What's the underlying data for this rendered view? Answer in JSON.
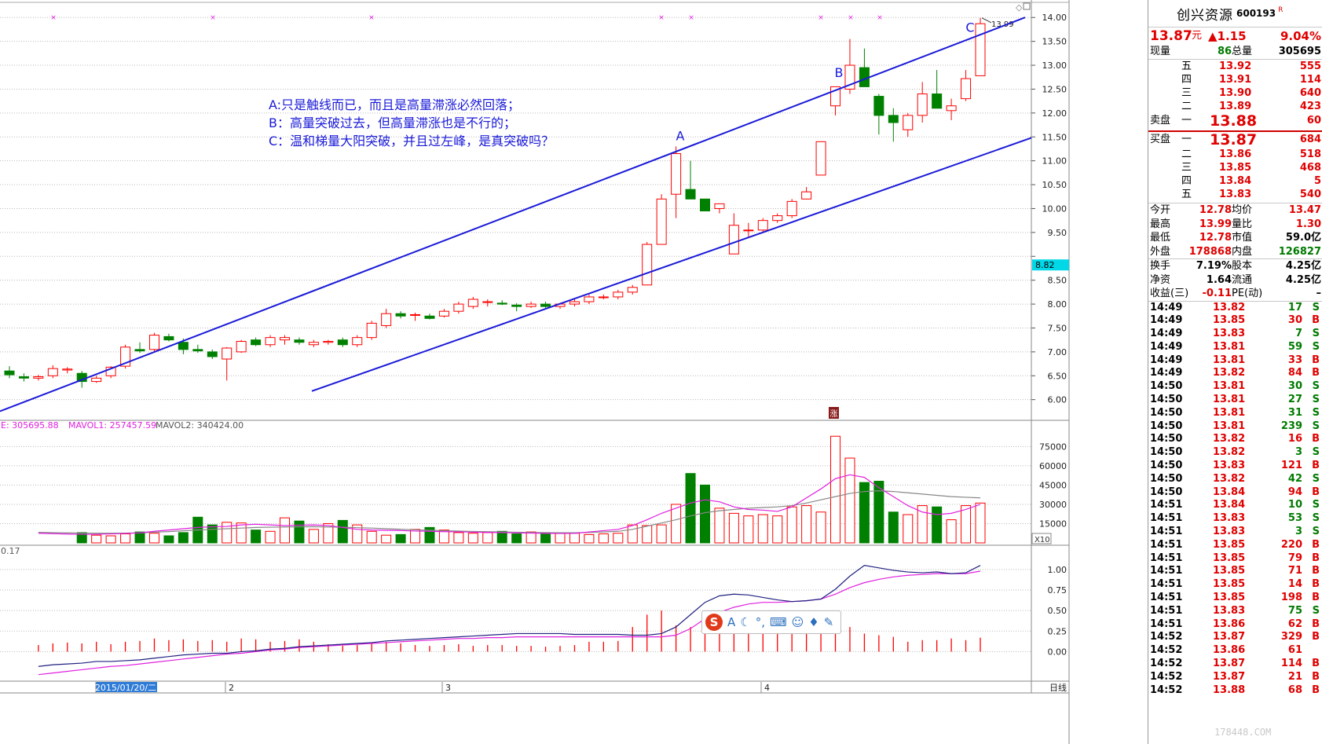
{
  "chart_data": {
    "type": "candlestick",
    "price_axis": {
      "ticks": [
        14.0,
        13.5,
        13.0,
        12.5,
        12.0,
        11.5,
        11.0,
        10.5,
        10.0,
        9.5,
        9.0,
        8.5,
        8.0,
        7.5,
        7.0,
        6.5,
        6.0
      ],
      "labels": [
        "14.00",
        "13.50",
        "13.00",
        "12.50",
        "12.00",
        "11.50",
        "11.00",
        "10.50",
        "10.00",
        "9.50",
        "",
        "8.50",
        "8.00",
        "7.50",
        "7.00",
        "6.50",
        "6.00"
      ],
      "range": [
        5.6,
        14.3
      ]
    },
    "cursor_price": "8.82",
    "high_mark": "13.99",
    "candles": [
      {
        "o": 6.6,
        "h": 6.7,
        "l": 6.45,
        "c": 6.52
      },
      {
        "o": 6.48,
        "h": 6.55,
        "l": 6.38,
        "c": 6.45
      },
      {
        "o": 6.45,
        "h": 6.52,
        "l": 6.4,
        "c": 6.48
      },
      {
        "o": 6.5,
        "h": 6.72,
        "l": 6.45,
        "c": 6.65
      },
      {
        "o": 6.62,
        "h": 6.68,
        "l": 6.55,
        "c": 6.64
      },
      {
        "o": 6.55,
        "h": 6.6,
        "l": 6.25,
        "c": 6.38
      },
      {
        "o": 6.38,
        "h": 6.5,
        "l": 6.35,
        "c": 6.45
      },
      {
        "o": 6.5,
        "h": 6.7,
        "l": 6.45,
        "c": 6.68
      },
      {
        "o": 6.7,
        "h": 7.15,
        "l": 6.65,
        "c": 7.1
      },
      {
        "o": 7.05,
        "h": 7.2,
        "l": 6.98,
        "c": 7.02
      },
      {
        "o": 7.05,
        "h": 7.4,
        "l": 7.0,
        "c": 7.35
      },
      {
        "o": 7.32,
        "h": 7.38,
        "l": 7.22,
        "c": 7.25
      },
      {
        "o": 7.2,
        "h": 7.28,
        "l": 6.95,
        "c": 7.05
      },
      {
        "o": 7.05,
        "h": 7.15,
        "l": 6.98,
        "c": 7.02
      },
      {
        "o": 7.0,
        "h": 7.05,
        "l": 6.85,
        "c": 6.9
      },
      {
        "o": 6.85,
        "h": 7.1,
        "l": 6.4,
        "c": 7.08
      },
      {
        "o": 7.0,
        "h": 7.25,
        "l": 6.98,
        "c": 7.22
      },
      {
        "o": 7.25,
        "h": 7.3,
        "l": 7.12,
        "c": 7.15
      },
      {
        "o": 7.15,
        "h": 7.35,
        "l": 7.1,
        "c": 7.3
      },
      {
        "o": 7.25,
        "h": 7.35,
        "l": 7.15,
        "c": 7.3
      },
      {
        "o": 7.25,
        "h": 7.3,
        "l": 7.15,
        "c": 7.2
      },
      {
        "o": 7.15,
        "h": 7.25,
        "l": 7.1,
        "c": 7.2
      },
      {
        "o": 7.2,
        "h": 7.25,
        "l": 7.15,
        "c": 7.22
      },
      {
        "o": 7.25,
        "h": 7.3,
        "l": 7.1,
        "c": 7.15
      },
      {
        "o": 7.15,
        "h": 7.35,
        "l": 7.1,
        "c": 7.3
      },
      {
        "o": 7.3,
        "h": 7.65,
        "l": 7.25,
        "c": 7.6
      },
      {
        "o": 7.55,
        "h": 7.9,
        "l": 7.5,
        "c": 7.8
      },
      {
        "o": 7.8,
        "h": 7.85,
        "l": 7.7,
        "c": 7.75
      },
      {
        "o": 7.78,
        "h": 7.82,
        "l": 7.65,
        "c": 7.78
      },
      {
        "o": 7.75,
        "h": 7.8,
        "l": 7.68,
        "c": 7.7
      },
      {
        "o": 7.75,
        "h": 7.9,
        "l": 7.72,
        "c": 7.85
      },
      {
        "o": 7.85,
        "h": 8.05,
        "l": 7.8,
        "c": 8.0
      },
      {
        "o": 7.95,
        "h": 8.15,
        "l": 7.9,
        "c": 8.1
      },
      {
        "o": 8.05,
        "h": 8.1,
        "l": 7.95,
        "c": 8.05
      },
      {
        "o": 8.02,
        "h": 8.08,
        "l": 7.98,
        "c": 8.0
      },
      {
        "o": 7.98,
        "h": 8.02,
        "l": 7.85,
        "c": 7.95
      },
      {
        "o": 7.95,
        "h": 8.05,
        "l": 7.92,
        "c": 8.0
      },
      {
        "o": 8.0,
        "h": 8.05,
        "l": 7.92,
        "c": 7.95
      },
      {
        "o": 7.95,
        "h": 8.02,
        "l": 7.9,
        "c": 8.0
      },
      {
        "o": 8.0,
        "h": 8.1,
        "l": 7.95,
        "c": 8.05
      },
      {
        "o": 8.05,
        "h": 8.2,
        "l": 8.0,
        "c": 8.15
      },
      {
        "o": 8.15,
        "h": 8.2,
        "l": 8.1,
        "c": 8.15
      },
      {
        "o": 8.15,
        "h": 8.3,
        "l": 8.1,
        "c": 8.25
      },
      {
        "o": 8.25,
        "h": 8.4,
        "l": 8.2,
        "c": 8.35
      },
      {
        "o": 8.4,
        "h": 9.3,
        "l": 8.4,
        "c": 9.25
      },
      {
        "o": 9.25,
        "h": 10.3,
        "l": 9.4,
        "c": 10.2
      },
      {
        "o": 10.3,
        "h": 11.3,
        "l": 9.8,
        "c": 11.15
      },
      {
        "o": 10.4,
        "h": 11.0,
        "l": 10.3,
        "c": 10.2
      },
      {
        "o": 10.2,
        "h": 10.2,
        "l": 9.95,
        "c": 9.95
      },
      {
        "o": 10.0,
        "h": 10.1,
        "l": 9.9,
        "c": 10.1
      },
      {
        "o": 9.05,
        "h": 9.9,
        "l": 9.05,
        "c": 9.65
      },
      {
        "o": 9.55,
        "h": 9.7,
        "l": 9.4,
        "c": 9.55
      },
      {
        "o": 9.55,
        "h": 9.8,
        "l": 9.5,
        "c": 9.75
      },
      {
        "o": 9.75,
        "h": 9.9,
        "l": 9.7,
        "c": 9.85
      },
      {
        "o": 9.85,
        "h": 10.2,
        "l": 9.8,
        "c": 10.15
      },
      {
        "o": 10.2,
        "h": 10.45,
        "l": 10.2,
        "c": 10.35
      },
      {
        "o": 10.7,
        "h": 11.4,
        "l": 10.7,
        "c": 11.4
      },
      {
        "o": 12.15,
        "h": 12.55,
        "l": 11.95,
        "c": 12.55
      },
      {
        "o": 12.5,
        "h": 13.55,
        "l": 12.4,
        "c": 13.0
      },
      {
        "o": 12.95,
        "h": 13.35,
        "l": 12.55,
        "c": 12.55
      },
      {
        "o": 12.35,
        "h": 12.4,
        "l": 11.55,
        "c": 11.95
      },
      {
        "o": 11.95,
        "h": 12.1,
        "l": 11.4,
        "c": 11.8
      },
      {
        "o": 11.65,
        "h": 12.0,
        "l": 11.5,
        "c": 11.95
      },
      {
        "o": 11.95,
        "h": 12.65,
        "l": 11.8,
        "c": 12.4
      },
      {
        "o": 12.4,
        "h": 12.9,
        "l": 12.15,
        "c": 12.1
      },
      {
        "o": 12.05,
        "h": 12.3,
        "l": 11.85,
        "c": 12.15
      },
      {
        "o": 12.3,
        "h": 12.9,
        "l": 12.25,
        "c": 12.72
      },
      {
        "o": 12.78,
        "h": 13.99,
        "l": 12.78,
        "c": 13.87
      }
    ],
    "channel_upper": {
      "from": [
        0,
        6.02
      ],
      "to": [
        1305,
        14.0
      ]
    },
    "channel_lower": {
      "from": [
        397,
        6.08
      ],
      "to": [
        1313,
        11.48
      ]
    },
    "markers": [
      {
        "label": "A",
        "x": 866,
        "price": 11.4
      },
      {
        "label": "B",
        "x": 1068,
        "price": 12.72
      },
      {
        "label": "C",
        "x": 1235,
        "price": 13.67
      }
    ],
    "annotations": [
      "A:只是触线而已，而且是高量滞涨必然回落；",
      "B：高量突破过去，但高量滞涨也是不行的；",
      "C：温和梯量大阳突破，并且过左峰，是真突破吗？"
    ],
    "volume": {
      "header": [
        "E: 305695.88",
        "MAVOL1: 257457.59",
        "MAVOL2: 340424.00"
      ],
      "ticks": [
        75000,
        60000,
        45000,
        30000,
        15000
      ],
      "labels": [
        "75000",
        "60000",
        "45000",
        "30000",
        "15000"
      ],
      "unit": "X10",
      "ylim": [
        0,
        85000
      ],
      "values": [
        8000,
        6000,
        5500,
        7000,
        8500,
        7500,
        5500,
        8000,
        20000,
        14000,
        16000,
        15500,
        10000,
        9000,
        19500,
        17000,
        10500,
        15000,
        17500,
        14000,
        9000,
        6000,
        6500,
        10500,
        12000,
        10000,
        8000,
        7500,
        8000,
        9000,
        7000,
        8500,
        8000,
        7500,
        7500,
        6500,
        7000,
        7500,
        14000,
        13500,
        14000,
        30000,
        54000,
        45000,
        27000,
        23000,
        21000,
        22000,
        21000,
        28000,
        29000,
        24000,
        83000,
        66000,
        47000,
        48000,
        24000,
        22000,
        29000,
        28000,
        18000,
        29000,
        31000
      ],
      "ma1": [
        7500,
        7200,
        6900,
        6600,
        6700,
        7000,
        7300,
        7800,
        9000,
        10000,
        11000,
        12000,
        12500,
        12800,
        14000,
        14500,
        14000,
        13500,
        13800,
        14000,
        13500,
        12000,
        10500,
        10000,
        9800,
        9600,
        9200,
        9000,
        8700,
        8600,
        8300,
        8200,
        8000,
        7800,
        7600,
        7400,
        7300,
        7400,
        8500,
        9500,
        10500,
        13500,
        18000,
        23000,
        27000,
        31000,
        33500,
        32000,
        28000,
        26000,
        25500,
        24500,
        28000,
        35000,
        42000,
        50000,
        53000,
        51000,
        43000,
        36000,
        29000,
        24000,
        22000,
        23000,
        26000,
        30000
      ],
      "ma2": [
        8200,
        8000,
        7800,
        7600,
        7500,
        7500,
        7600,
        7800,
        8300,
        8800,
        9400,
        10000,
        10500,
        11000,
        11500,
        12000,
        12200,
        12400,
        12500,
        12600,
        12400,
        12200,
        11800,
        11500,
        11000,
        10600,
        10200,
        9800,
        9500,
        9200,
        8900,
        8700,
        8500,
        8300,
        8100,
        8000,
        7900,
        7900,
        8100,
        8500,
        9000,
        10500,
        13000,
        15500,
        18000,
        21000,
        23500,
        25000,
        26000,
        27000,
        27500,
        28000,
        29000,
        31000,
        33500,
        36000,
        38500,
        40000,
        40500,
        40000,
        39000,
        38000,
        37000,
        36000,
        35500,
        35000
      ]
    },
    "indicator": {
      "header": "0.17",
      "ticks": [
        1.0,
        0.75,
        0.5,
        0.25,
        0.0
      ],
      "labels": [
        "1.00",
        "0.75",
        "0.50",
        "0.25",
        "0.00"
      ],
      "ylim": [
        -0.35,
        1.2
      ],
      "bars": [
        0.08,
        0.1,
        0.11,
        0.1,
        0.12,
        0.09,
        0.12,
        0.13,
        0.16,
        0.14,
        0.15,
        0.13,
        0.14,
        0.12,
        0.16,
        0.15,
        0.12,
        0.13,
        0.15,
        0.12,
        0.09,
        0.07,
        0.08,
        0.1,
        0.12,
        0.1,
        0.08,
        0.07,
        0.08,
        0.09,
        0.07,
        0.08,
        0.08,
        0.07,
        0.07,
        0.06,
        0.07,
        0.08,
        0.12,
        0.12,
        0.13,
        0.3,
        0.45,
        0.5,
        0.32,
        0.3,
        0.28,
        0.3,
        0.29,
        0.36,
        0.38,
        0.33,
        0.5,
        0.5,
        0.48,
        0.45,
        0.3,
        0.22,
        0.2,
        0.18,
        0.12,
        0.14,
        0.14,
        0.16,
        0.14,
        0.17
      ],
      "line1": [
        -0.18,
        -0.16,
        -0.15,
        -0.14,
        -0.12,
        -0.12,
        -0.11,
        -0.1,
        -0.08,
        -0.06,
        -0.04,
        -0.03,
        -0.02,
        -0.02,
        0.0,
        0.01,
        0.03,
        0.04,
        0.06,
        0.07,
        0.08,
        0.09,
        0.1,
        0.11,
        0.13,
        0.14,
        0.15,
        0.16,
        0.17,
        0.18,
        0.19,
        0.2,
        0.21,
        0.22,
        0.22,
        0.22,
        0.22,
        0.21,
        0.21,
        0.21,
        0.21,
        0.2,
        0.2,
        0.22,
        0.3,
        0.45,
        0.6,
        0.68,
        0.7,
        0.69,
        0.66,
        0.63,
        0.61,
        0.62,
        0.64,
        0.76,
        0.92,
        1.05,
        1.02,
        0.99,
        0.97,
        0.96,
        0.97,
        0.95,
        0.96,
        1.05
      ],
      "line2": [
        -0.28,
        -0.26,
        -0.24,
        -0.22,
        -0.2,
        -0.18,
        -0.17,
        -0.15,
        -0.13,
        -0.11,
        -0.09,
        -0.07,
        -0.05,
        -0.03,
        -0.02,
        0.0,
        0.02,
        0.03,
        0.05,
        0.06,
        0.07,
        0.08,
        0.09,
        0.1,
        0.11,
        0.12,
        0.13,
        0.14,
        0.15,
        0.16,
        0.16,
        0.17,
        0.17,
        0.18,
        0.18,
        0.18,
        0.18,
        0.18,
        0.18,
        0.18,
        0.18,
        0.18,
        0.18,
        0.18,
        0.2,
        0.28,
        0.4,
        0.48,
        0.54,
        0.58,
        0.6,
        0.6,
        0.61,
        0.62,
        0.64,
        0.7,
        0.78,
        0.84,
        0.88,
        0.91,
        0.93,
        0.94,
        0.95,
        0.95,
        0.95,
        0.98
      ]
    },
    "x_axis": {
      "labels": [
        {
          "text": "2015/01/20/二",
          "x": 160,
          "highlight": true
        },
        {
          "text": "2",
          "x": 291,
          "highlight": false
        },
        {
          "text": "3",
          "x": 567,
          "highlight": false
        },
        {
          "text": "4",
          "x": 973,
          "highlight": false
        },
        {
          "text": "日线",
          "x": 1336,
          "highlight": false
        }
      ]
    },
    "limit_up_tag": "涨"
  },
  "panel": {
    "name": "创兴资源",
    "code": "600193",
    "rights": "R",
    "price": "13.87",
    "price_unit": "元",
    "change": "▲1.15",
    "change_pct": "9.04%",
    "now_vol_label": "现量",
    "now_vol": "86",
    "total_vol_label": "总量",
    "total_vol": "305695",
    "asks": [
      {
        "lvl": "五",
        "price": "13.92",
        "vol": "555"
      },
      {
        "lvl": "四",
        "price": "13.91",
        "vol": "114"
      },
      {
        "lvl": "三",
        "price": "13.90",
        "vol": "640"
      },
      {
        "lvl": "二",
        "price": "13.89",
        "vol": "423"
      },
      {
        "lvl": "一",
        "price": "13.88",
        "vol": "60"
      }
    ],
    "ask_label": "卖盘",
    "bid_label": "买盘",
    "bids": [
      {
        "lvl": "一",
        "price": "13.87",
        "vol": "684"
      },
      {
        "lvl": "二",
        "price": "13.86",
        "vol": "518"
      },
      {
        "lvl": "三",
        "price": "13.85",
        "vol": "468"
      },
      {
        "lvl": "四",
        "price": "13.84",
        "vol": "5"
      },
      {
        "lvl": "五",
        "price": "13.83",
        "vol": "540"
      }
    ],
    "stats": [
      {
        "l1": "今开",
        "v1": "12.78",
        "l2": "均价",
        "v2": "13.47"
      },
      {
        "l1": "最高",
        "v1": "13.99",
        "l2": "量比",
        "v2": "1.30"
      },
      {
        "l1": "最低",
        "v1": "12.78",
        "l2": "市值",
        "v2": "59.0亿"
      },
      {
        "l1": "外盘",
        "v1": "178868",
        "l2": "内盘",
        "v2": "126827"
      }
    ],
    "stats2": [
      {
        "l1": "换手",
        "v1": "7.19%",
        "l2": "股本",
        "v2": "4.25亿"
      },
      {
        "l1": "净资",
        "v1": "1.64",
        "l2": "流通",
        "v2": "4.25亿"
      },
      {
        "l1": "收益(三)",
        "v1": "-0.11",
        "l2": "PE(动)",
        "v2": "–"
      }
    ],
    "ticks": [
      {
        "t": "14:49",
        "p": "13.82",
        "v": "17",
        "s": "S"
      },
      {
        "t": "14:49",
        "p": "13.85",
        "v": "30",
        "s": "B"
      },
      {
        "t": "14:49",
        "p": "13.83",
        "v": "7",
        "s": "S"
      },
      {
        "t": "14:49",
        "p": "13.81",
        "v": "59",
        "s": "S"
      },
      {
        "t": "14:49",
        "p": "13.81",
        "v": "33",
        "s": "B"
      },
      {
        "t": "14:49",
        "p": "13.82",
        "v": "84",
        "s": "B"
      },
      {
        "t": "14:50",
        "p": "13.81",
        "v": "30",
        "s": "S"
      },
      {
        "t": "14:50",
        "p": "13.81",
        "v": "27",
        "s": "S"
      },
      {
        "t": "14:50",
        "p": "13.81",
        "v": "31",
        "s": "S"
      },
      {
        "t": "14:50",
        "p": "13.81",
        "v": "239",
        "s": "S"
      },
      {
        "t": "14:50",
        "p": "13.82",
        "v": "16",
        "s": "B"
      },
      {
        "t": "14:50",
        "p": "13.82",
        "v": "3",
        "s": "S"
      },
      {
        "t": "14:50",
        "p": "13.83",
        "v": "121",
        "s": "B"
      },
      {
        "t": "14:50",
        "p": "13.82",
        "v": "42",
        "s": "S"
      },
      {
        "t": "14:50",
        "p": "13.84",
        "v": "94",
        "s": "B"
      },
      {
        "t": "14:51",
        "p": "13.84",
        "v": "10",
        "s": "S"
      },
      {
        "t": "14:51",
        "p": "13.83",
        "v": "53",
        "s": "S"
      },
      {
        "t": "14:51",
        "p": "13.83",
        "v": "3",
        "s": "S"
      },
      {
        "t": "14:51",
        "p": "13.85",
        "v": "220",
        "s": "B"
      },
      {
        "t": "14:51",
        "p": "13.85",
        "v": "79",
        "s": "B"
      },
      {
        "t": "14:51",
        "p": "13.85",
        "v": "71",
        "s": "B"
      },
      {
        "t": "14:51",
        "p": "13.85",
        "v": "14",
        "s": "B"
      },
      {
        "t": "14:51",
        "p": "13.85",
        "v": "198",
        "s": "B"
      },
      {
        "t": "14:51",
        "p": "13.83",
        "v": "75",
        "s": "S"
      },
      {
        "t": "14:51",
        "p": "13.86",
        "v": "62",
        "s": "B"
      },
      {
        "t": "14:52",
        "p": "13.87",
        "v": "329",
        "s": "B"
      },
      {
        "t": "14:52",
        "p": "13.86",
        "v": "61",
        "s": ""
      },
      {
        "t": "14:52",
        "p": "13.87",
        "v": "114",
        "s": "B"
      },
      {
        "t": "14:52",
        "p": "13.87",
        "v": "21",
        "s": "B"
      },
      {
        "t": "14:52",
        "p": "13.88",
        "v": "68",
        "s": "B"
      }
    ],
    "watermark": "178448.COM"
  },
  "colors": {
    "up": "#ff0000",
    "down": "#008000",
    "channel": "#1a1ad8",
    "ma1": "#e020e0",
    "ma2": "#888888",
    "ind1": "#202080"
  }
}
